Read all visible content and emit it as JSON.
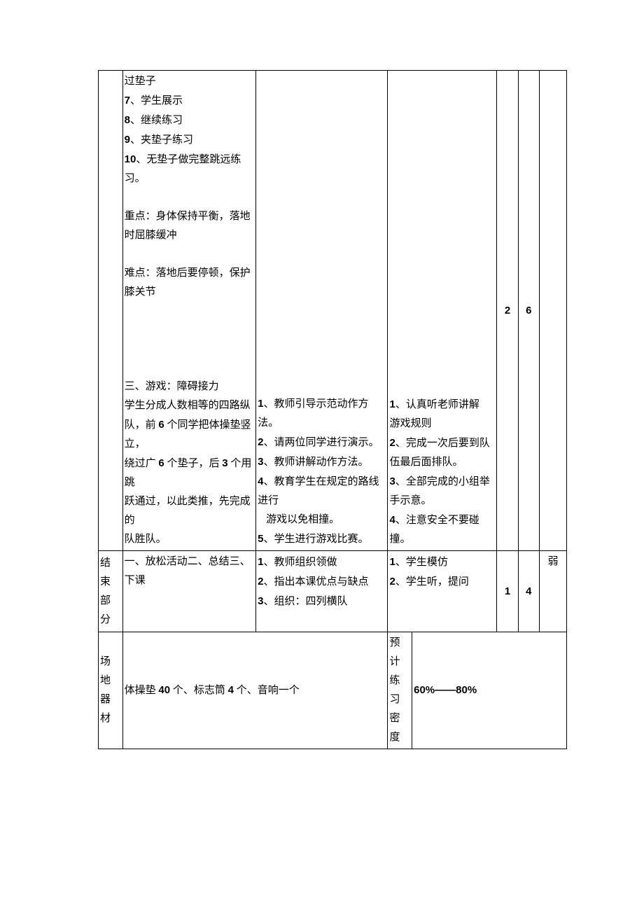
{
  "row1": {
    "col_b": {
      "l1": "过垫子",
      "l2a": "7",
      "l2b": "、学生展示",
      "l3a": "8",
      "l3b": "、继续练习",
      "l4a": "9",
      "l4b": "、夹垫子练习",
      "l5a": "10",
      "l5b": "、无垫子做完整跳远练",
      "l6": "习。",
      "l7": "重点：身体保持平衡，落地",
      "l8": "时屈膝缓冲",
      "l9": "难点：落地后要停顿，保护",
      "l10": "膝关节",
      "l11": "三、游戏：障碍接力",
      "l12": "学生分成人数相等的四路纵",
      "l13a": "队，前 ",
      "l13b": "6",
      "l13c": " 个同学把体操垫竖立，",
      "l14a": "绕过广 ",
      "l14b": "6",
      "l14c": " 个垫子，后 ",
      "l14d": "3",
      "l14e": " 个用跳",
      "l15": "跃通过，以此类推，先完成的",
      "l16": "队胜队。"
    },
    "col_c": {
      "l1a": "1",
      "l1b": "、教师引导示范动作方法。",
      "l2a": "2",
      "l2b": "、请两位同学进行演示。",
      "l3a": "3",
      "l3b": "、教师讲解动作方法。",
      "l4a": "4",
      "l4b": "、教育学生在规定的路线进行",
      "l4c": "游戏以免相撞。",
      "l5a": "5",
      "l5b": "、学生进行游戏比赛。"
    },
    "col_de": {
      "l1a": "1",
      "l1b": "、认真听老师讲解",
      "l1c": "游戏规则",
      "l2a": "2",
      "l2b": "、完成一次后要到队",
      "l2c": "伍最后面排队。",
      "l3a": "3",
      "l3b": "、全部完成的小组举",
      "l3c": "手示意。",
      "l4a": "4",
      "l4b": "、注意安全不要碰",
      "l4c": "撞。"
    },
    "col_f": "2",
    "col_g": "6"
  },
  "row2": {
    "col_a": "结束部分",
    "col_b": "一、放松活动二、总结三、下课",
    "col_c": {
      "l1a": "1",
      "l1b": "、教师组织领做",
      "l2a": "2",
      "l2b": "、指出本课优点与缺点",
      "l3a": "3",
      "l3b": "、组织：四列横队"
    },
    "col_de": {
      "l1a": "1",
      "l1b": "、学生模仿",
      "l2a": "2",
      "l2b": "、学生听，提问"
    },
    "col_f": "1",
    "col_g": "4",
    "col_h": "弱"
  },
  "row3": {
    "col_a": "场地器材",
    "col_bc_a": "体操垫 ",
    "col_bc_b": "40",
    "col_bc_c": " 个、标志筒 ",
    "col_bc_d": "4",
    "col_bc_e": " 个、音响一个",
    "col_d": "预计练习密度",
    "col_e": "60%——80%"
  }
}
